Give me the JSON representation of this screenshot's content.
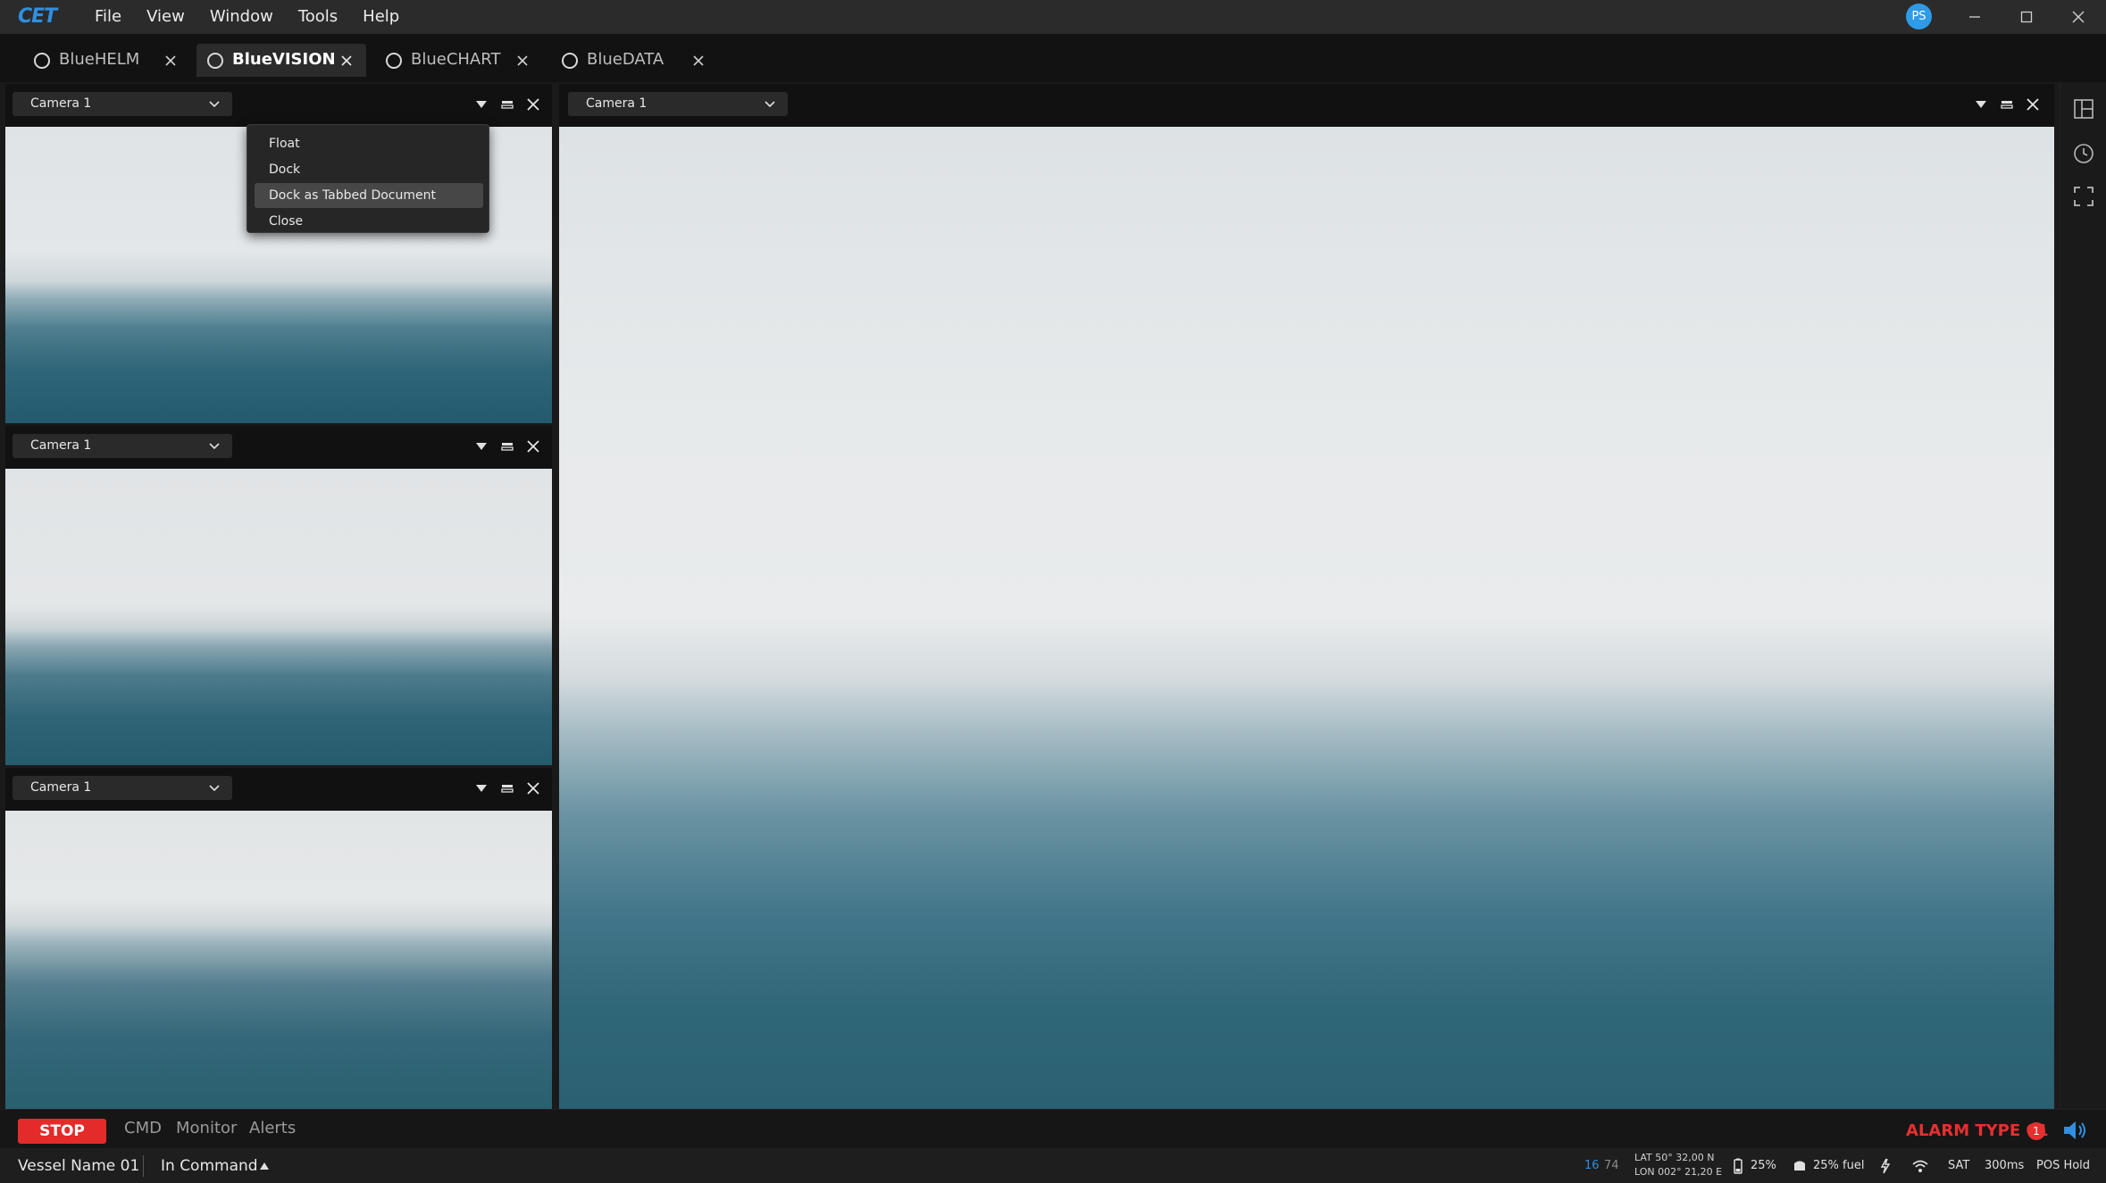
{
  "app": {
    "logo_text": "CET",
    "menu": [
      "File",
      "View",
      "Window",
      "Tools",
      "Help"
    ],
    "user_initials": "PS",
    "accent_color": "#2f8fe0"
  },
  "tabs": [
    {
      "label": "BlueHELM",
      "active": false
    },
    {
      "label": "BlueVISION",
      "active": true
    },
    {
      "label": "BlueCHART",
      "active": false
    },
    {
      "label": "BlueDATA",
      "active": false
    }
  ],
  "panels": [
    {
      "camera": "Camera 1"
    },
    {
      "camera": "Camera 1"
    },
    {
      "camera": "Camera 1"
    },
    {
      "camera": "Camera 1"
    }
  ],
  "context_menu": {
    "items": [
      "Float",
      "Dock",
      "Dock as Tabbed Document",
      "Close"
    ],
    "highlighted": "Dock as Tabbed Document"
  },
  "side_tools": [
    "layout-icon",
    "history-icon",
    "fullscreen-icon"
  ],
  "command_bar": {
    "stop_label": "STOP",
    "tabs": [
      "CMD",
      "Monitor",
      "Alerts"
    ],
    "alarm_text": "ALARM TYPE 01",
    "alarm_count": "1",
    "alarm_color": "#e63030"
  },
  "status_bar": {
    "vessel_name": "Vessel Name 01",
    "command_mode": "In Command",
    "num_a": "16",
    "num_b": "74",
    "lat": "LAT 50° 32,00 N",
    "lon": "LON 002° 21,20 E",
    "battery": "25%",
    "fuel": "25% fuel",
    "sat": "SAT",
    "latency": "300ms",
    "pos_mode": "POS Hold"
  }
}
